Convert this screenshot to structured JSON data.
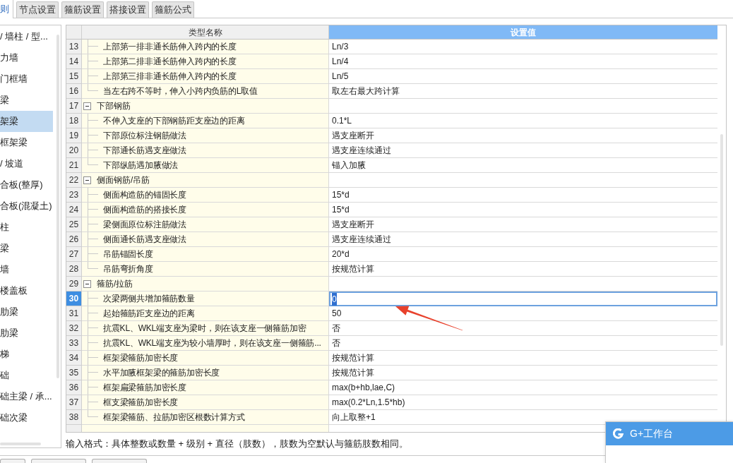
{
  "tabs": [
    {
      "label": "则",
      "selected": true
    },
    {
      "label": "节点设置",
      "selected": false
    },
    {
      "label": "箍筋设置",
      "selected": false
    },
    {
      "label": "搭接设置",
      "selected": false
    },
    {
      "label": "箍筋公式",
      "selected": false
    }
  ],
  "sidebar": {
    "items": [
      {
        "label": "/ 墙柱 / 型...",
        "selected": false
      },
      {
        "label": "力墙",
        "selected": false
      },
      {
        "label": "门框墙",
        "selected": false
      },
      {
        "label": "梁",
        "selected": false
      },
      {
        "label": "架梁",
        "selected": true
      },
      {
        "label": "框架梁",
        "selected": false
      },
      {
        "label": "/ 坡道",
        "selected": false
      },
      {
        "label": "合板(整厚)",
        "selected": false
      },
      {
        "label": "合板(混凝土)",
        "selected": false
      },
      {
        "label": "柱",
        "selected": false
      },
      {
        "label": "梁",
        "selected": false
      },
      {
        "label": "墙",
        "selected": false
      },
      {
        "label": "楼盖板",
        "selected": false
      },
      {
        "label": "肋梁",
        "selected": false
      },
      {
        "label": "肋梁",
        "selected": false
      },
      {
        "label": "梯",
        "selected": false
      },
      {
        "label": "础",
        "selected": false
      },
      {
        "label": "础主梁 / 承...",
        "selected": false
      },
      {
        "label": "础次梁",
        "selected": false
      }
    ]
  },
  "table": {
    "columns": [
      "类型名称",
      "设置值"
    ],
    "rows": [
      {
        "children": [
          {
            "number": "13",
            "name": "上部第一排非通长筋伸入跨内的长度",
            "value": "Ln/3",
            "selected": false
          },
          {
            "number": "14",
            "name": "上部第二排非通长筋伸入跨内的长度",
            "value": "Ln/4",
            "selected": false
          },
          {
            "number": "15",
            "name": "上部第三排非通长筋伸入跨内的长度",
            "value": "Ln/5",
            "selected": false
          },
          {
            "number": "16",
            "name": "当左右跨不等时，伸入小跨内负筋的L取值",
            "value": "取左右最大跨计算",
            "selected": false
          }
        ]
      },
      {
        "number": "17",
        "name": "下部钢筋",
        "expanded": true,
        "selected": false,
        "children": [
          {
            "number": "18",
            "name": "不伸入支座的下部钢筋距支座边的距离",
            "value": "0.1*L",
            "selected": false
          },
          {
            "number": "19",
            "name": "下部原位标注钢筋做法",
            "value": "遇支座断开",
            "selected": false
          },
          {
            "number": "20",
            "name": "下部通长筋遇支座做法",
            "value": "遇支座连续通过",
            "selected": false
          },
          {
            "number": "21",
            "name": "下部纵筋遇加腋做法",
            "value": "锚入加腋",
            "selected": false
          }
        ]
      },
      {
        "number": "22",
        "name": "侧面钢筋/吊筋",
        "expanded": true,
        "selected": false,
        "children": [
          {
            "number": "23",
            "name": "侧面构造筋的锚固长度",
            "value": "15*d",
            "selected": false
          },
          {
            "number": "24",
            "name": "侧面构造筋的搭接长度",
            "value": "15*d",
            "selected": false
          },
          {
            "number": "25",
            "name": "梁侧面原位标注筋做法",
            "value": "遇支座断开",
            "selected": false
          },
          {
            "number": "26",
            "name": "侧面通长筋遇支座做法",
            "value": "遇支座连续通过",
            "selected": false
          },
          {
            "number": "27",
            "name": "吊筋锚固长度",
            "value": "20*d",
            "selected": false
          },
          {
            "number": "28",
            "name": "吊筋弯折角度",
            "value": "按规范计算",
            "selected": false
          }
        ]
      },
      {
        "number": "29",
        "name": "箍筋/拉筋",
        "expanded": true,
        "selected": false,
        "children": [
          {
            "number": "30",
            "name": "次梁两侧共增加箍筋数量",
            "value": "0",
            "selected": true
          },
          {
            "number": "31",
            "name": "起始箍筋距支座边的距离",
            "value": "50",
            "selected": false
          },
          {
            "number": "32",
            "name": "抗震KL、WKL端支座为梁时，则在该支座一侧箍筋加密",
            "value": "否",
            "selected": false
          },
          {
            "number": "33",
            "name": "抗震KL、WKL端支座为较小墙厚时，则在该支座一侧箍筋...",
            "value": "否",
            "selected": false
          },
          {
            "number": "34",
            "name": "框架梁箍筋加密长度",
            "value": "按规范计算",
            "selected": false
          },
          {
            "number": "35",
            "name": "水平加腋框架梁的箍筋加密长度",
            "value": "按规范计算",
            "selected": false
          },
          {
            "number": "36",
            "name": "框架扁梁箍筋加密长度",
            "value": "max(b+hb,lae,C)",
            "selected": false
          },
          {
            "number": "37",
            "name": "框支梁箍筋加密长度",
            "value": "max(0.2*Ln,1.5*hb)",
            "selected": false
          },
          {
            "number": "38",
            "name": "框架梁箍筋、拉筋加密区根数计算方式",
            "value": "向上取整+1",
            "selected": false
          }
        ]
      }
    ]
  },
  "hint": "输入格式：具体整数或数量 + 级别 + 直径（肢数），肢数为空默认与箍筋肢数相同。",
  "popup": {
    "title": "G+工作台"
  }
}
